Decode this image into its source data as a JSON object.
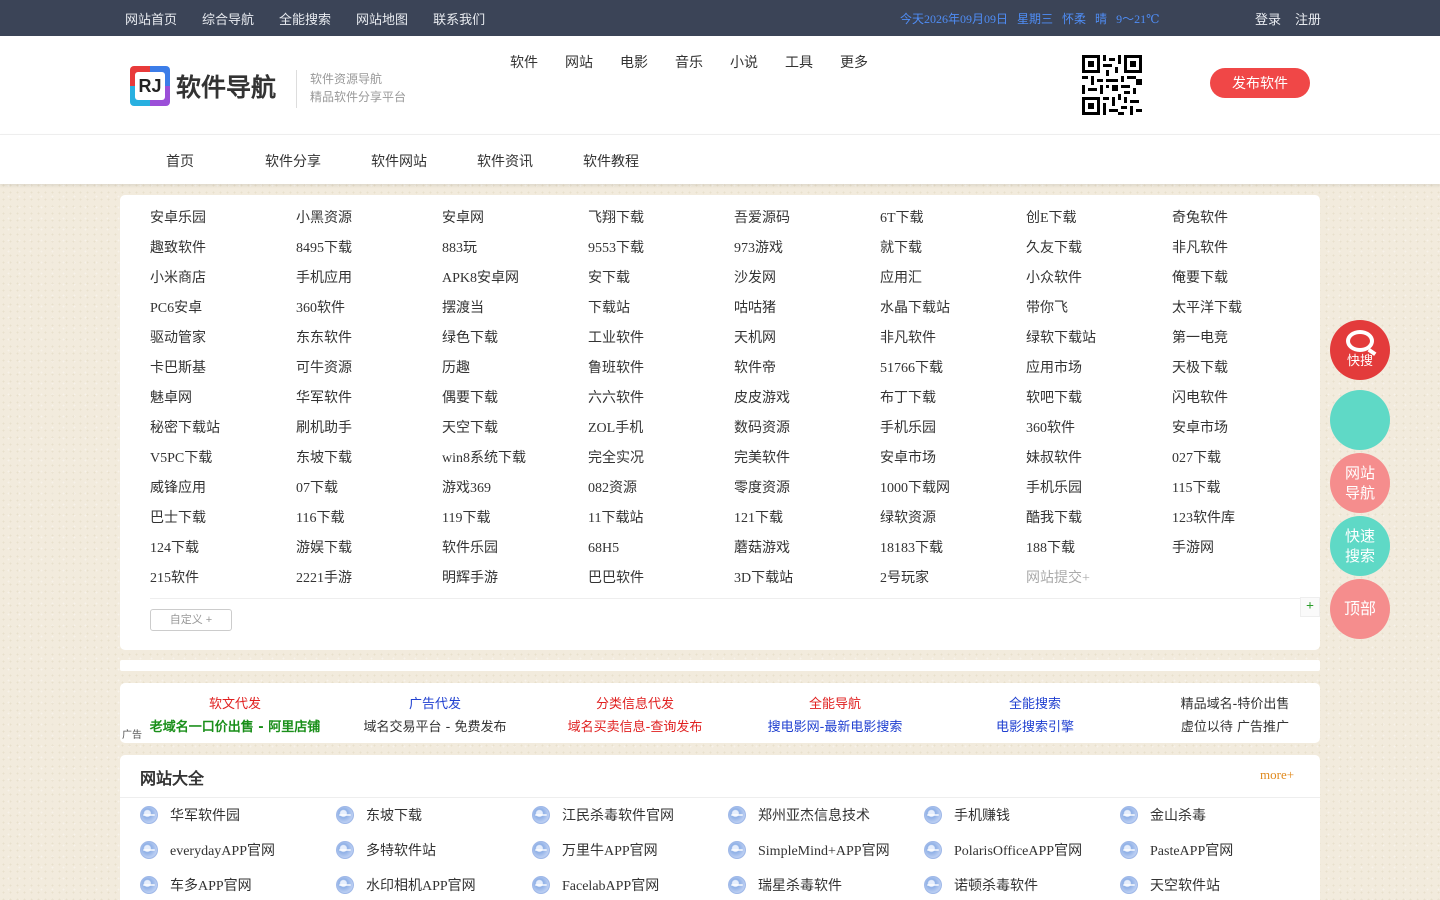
{
  "topbar": {
    "links": [
      "网站首页",
      "综合导航",
      "全能搜索",
      "网站地图",
      "联系我们"
    ],
    "weather": [
      "今天2026年09月09日",
      "星期三",
      "怀柔",
      "晴",
      "9～21℃"
    ],
    "login": "登录",
    "register": "注册"
  },
  "header": {
    "logo_mark": "RJ",
    "logo_text": "软件导航",
    "tagline1": "软件资源导航",
    "tagline2": "精品软件分享平台",
    "nav": [
      "软件",
      "网站",
      "电影",
      "音乐",
      "小说",
      "工具",
      "更多"
    ],
    "publish": "发布软件"
  },
  "mainnav": [
    "首页",
    "软件分享",
    "软件网站",
    "软件资讯",
    "软件教程"
  ],
  "sites": [
    "安卓乐园",
    "小黑资源",
    "安卓网",
    "飞翔下载",
    "吾爱源码",
    "6T下载",
    "创E下载",
    "奇兔软件",
    "趣致软件",
    "8495下载",
    "883玩",
    "9553下载",
    "973游戏",
    "就下载",
    "久友下载",
    "非凡软件",
    "小米商店",
    "手机应用",
    "APK8安卓网",
    "安下载",
    "沙发网",
    "应用汇",
    "小众软件",
    "俺要下载",
    "PC6安卓",
    "360软件",
    "摆渡当",
    "下载站",
    "咕咕猪",
    "水晶下载站",
    "带你飞",
    "太平洋下载",
    "驱动管家",
    "东东软件",
    "绿色下载",
    "工业软件",
    "天机网",
    "非凡软件",
    "绿软下载站",
    "第一电竞",
    "卡巴斯基",
    "可牛资源",
    "历趣",
    "鲁班软件",
    "软件帝",
    "51766下载",
    "应用市场",
    "天极下载",
    "魅卓网",
    "华军软件",
    "偶要下载",
    "六六软件",
    "皮皮游戏",
    "布丁下载",
    "软吧下载",
    "闪电软件",
    "秘密下载站",
    "刷机助手",
    "天空下载",
    "ZOL手机",
    "数码资源",
    "手机乐园",
    "360软件",
    "安卓市场",
    "V5PC下载",
    "东坡下载",
    "win8系统下载",
    "完全实况",
    "完美软件",
    "安卓市场",
    "妹叔软件",
    "027下载",
    "威锋应用",
    "07下载",
    "游戏369",
    "082资源",
    "零度资源",
    "1000下载网",
    "手机乐园",
    "115下载",
    "巴士下载",
    "116下载",
    "119下载",
    "11下载站",
    "121下载",
    "绿软资源",
    "酷我下载",
    "123软件库",
    "124下载",
    "游娱下载",
    "软件乐园",
    "68H5",
    "蘑菇游戏",
    "18183下载",
    "188下载",
    "手游网",
    "215软件",
    "2221手游",
    "明辉手游",
    "巴巴软件",
    "3D下载站",
    "2号玩家"
  ],
  "site_submit": "网站提交+",
  "custom_btn": "自定义 +",
  "plus_btn": "+",
  "ads": {
    "tag": "广告",
    "items": [
      {
        "top": "软文代发",
        "top_color": "#e02020",
        "bottom": "老域名一口价出售 - 阿里店铺",
        "bottom_color": "#1a8f1a"
      },
      {
        "top": "广告代发",
        "top_color": "#2040d0",
        "bottom": "域名交易平台 - 免费发布",
        "bottom_color": "#333333"
      },
      {
        "top": "分类信息代发",
        "top_color": "#e02020",
        "bottom": "域名买卖信息-查询发布",
        "bottom_color": "#e02020"
      },
      {
        "top": "全能导航",
        "top_color": "#e02020",
        "bottom": "搜电影网-最新电影搜索",
        "bottom_color": "#2040d0"
      },
      {
        "top": "全能搜索",
        "top_color": "#2040d0",
        "bottom": "电影搜索引擎",
        "bottom_color": "#2040d0"
      },
      {
        "top": "精品域名-特价出售",
        "top_color": "#333333",
        "bottom": "虚位以待 广告推广",
        "bottom_color": "#333333"
      }
    ]
  },
  "directory": {
    "title": "网站大全",
    "more": "more+",
    "items": [
      "华军软件园",
      "东坡下载",
      "江民杀毒软件官网",
      "郑州亚杰信息技术",
      "手机赚钱",
      "金山杀毒",
      "everydayAPP官网",
      "多特软件站",
      "万里牛APP官网",
      "SimpleMind+APP官网",
      "PolarisOfficeAPP官网",
      "PasteAPP官网",
      "车多APP官网",
      "水印相机APP官网",
      "FacelabAPP官网",
      "瑞星杀毒软件",
      "诺顿杀毒软件",
      "天空软件站"
    ]
  },
  "float": {
    "search": "快搜",
    "nav1": "网站",
    "nav2": "导航",
    "quick1": "快速",
    "quick2": "搜索",
    "top": "顶部"
  },
  "colors": {
    "topbar_bg": "#3b4457",
    "accent_red": "#f04747",
    "weather_blue": "#4f8df5",
    "teal": "#5fd9c6",
    "pink": "#f58d8d"
  }
}
